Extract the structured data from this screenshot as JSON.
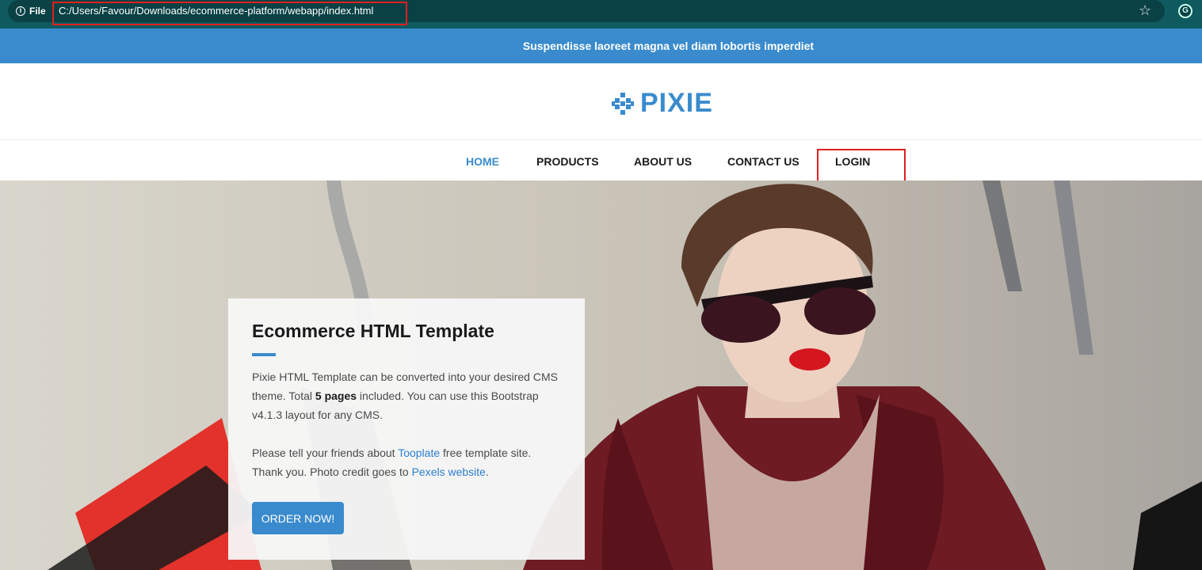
{
  "browser": {
    "site_info_label": "File",
    "url": "C:/Users/Favour/Downloads/ecommerce-platform/webapp/index.html",
    "bookmark_icon": "star-icon",
    "extension_icon": "grammarly-icon"
  },
  "announcement": {
    "text": "Suspendisse laoreet magna vel diam lobortis imperdiet"
  },
  "brand": {
    "name": "PIXIE",
    "color": "#3a8bcd"
  },
  "nav": {
    "items": [
      {
        "label": "HOME",
        "active": true
      },
      {
        "label": "PRODUCTS",
        "active": false
      },
      {
        "label": "ABOUT US",
        "active": false
      },
      {
        "label": "CONTACT US",
        "active": false
      },
      {
        "label": "LOGIN",
        "active": false
      }
    ]
  },
  "hero": {
    "title": "Ecommerce HTML Template",
    "p1_before": "Pixie HTML Template can be converted into your desired CMS theme. Total ",
    "p1_bold": "5 pages",
    "p1_after": " included. You can use this Bootstrap v4.1.3 layout for any CMS.",
    "p2_before": "Please tell your friends about ",
    "p2_link1": "Tooplate",
    "p2_middle": " free template site. Thank you. Photo credit goes to ",
    "p2_link2": "Pexels website",
    "p2_after": ".",
    "button_label": "ORDER NOW!"
  },
  "colors": {
    "accent": "#3a8bcd",
    "highlight_box": "#e02020"
  }
}
